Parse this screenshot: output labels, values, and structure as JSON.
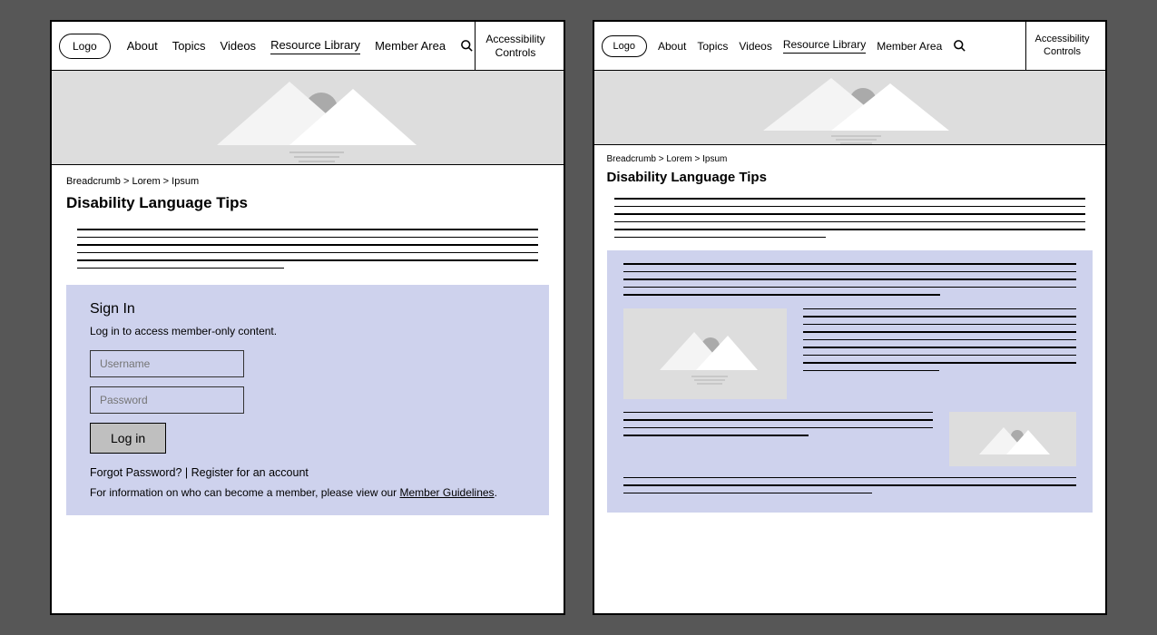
{
  "logo": "Logo",
  "nav": {
    "about": "About",
    "topics": "Topics",
    "videos": "Videos",
    "resource_library": "Resource Library",
    "member_area": "Member Area"
  },
  "a11y": "Accessibility Controls",
  "breadcrumb": "Breadcrumb > Lorem > Ipsum",
  "page_title": "Disability Language Tips",
  "signin": {
    "title": "Sign In",
    "subtitle": "Log in to access member-only content.",
    "username_placeholder": "Username",
    "password_placeholder": "Password",
    "login_label": "Log in",
    "forgot": "Forgot Password?",
    "separator": " | ",
    "register": "Register for an account",
    "info_prefix": "For information on who can become a member, please view our ",
    "guidelines": "Member Guidelines",
    "info_suffix": "."
  }
}
